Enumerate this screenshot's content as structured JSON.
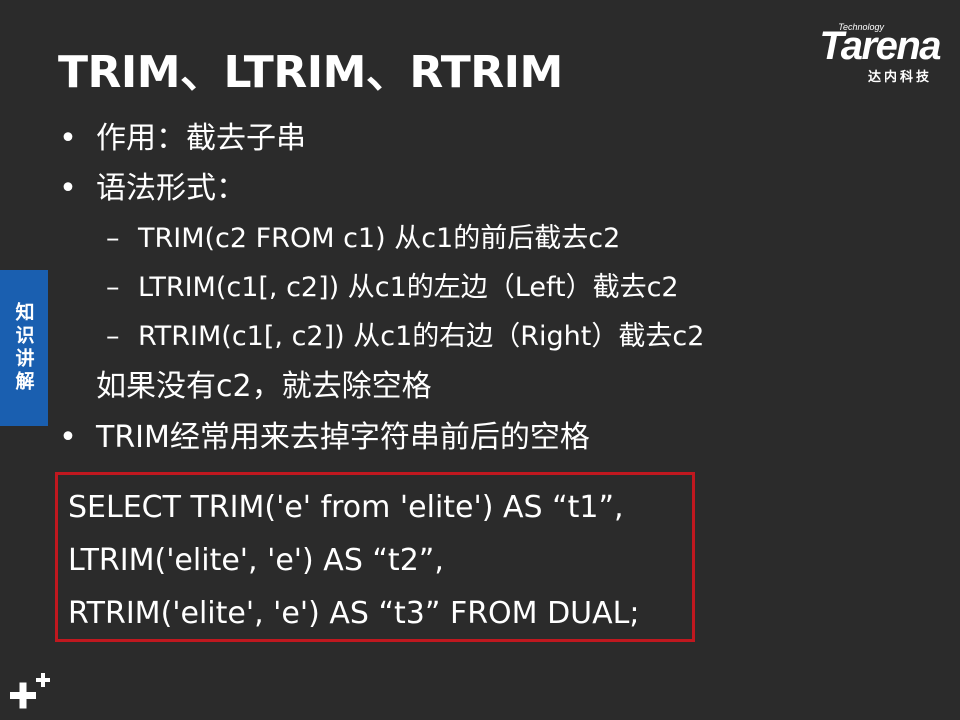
{
  "title": "TRIM、LTRIM、RTRIM",
  "logo": {
    "technology": "Technology",
    "brand": "Tarena",
    "chinese": "达内科技"
  },
  "side_tab": "知识讲解",
  "items": [
    {
      "level": 1,
      "marker": "•",
      "text": "作用：截去子串"
    },
    {
      "level": 1,
      "marker": "•",
      "text": "语法形式："
    },
    {
      "level": 2,
      "marker": "–",
      "text": "TRIM(c2 FROM c1)  从c1的前后截去c2"
    },
    {
      "level": 2,
      "marker": "–",
      "text": "LTRIM(c1[, c2])  从c1的左边（Left）截去c2"
    },
    {
      "level": 2,
      "marker": "–",
      "text": "RTRIM(c1[, c2])  从c1的右边（Right）截去c2"
    },
    {
      "level": 0,
      "marker": "",
      "text": "如果没有c2，就去除空格"
    },
    {
      "level": 1,
      "marker": "•",
      "text": "TRIM经常用来去掉字符串前后的空格"
    }
  ],
  "code": [
    "SELECT TRIM('e' from 'elite') AS  “t1”,",
    "LTRIM('elite', 'e') AS  “t2”,",
    "RTRIM('elite', 'e') AS  “t3”  FROM DUAL;"
  ],
  "colors": {
    "background": "#2b2b2b",
    "side_tab": "#1a5fb0",
    "code_border": "#c0181f"
  }
}
